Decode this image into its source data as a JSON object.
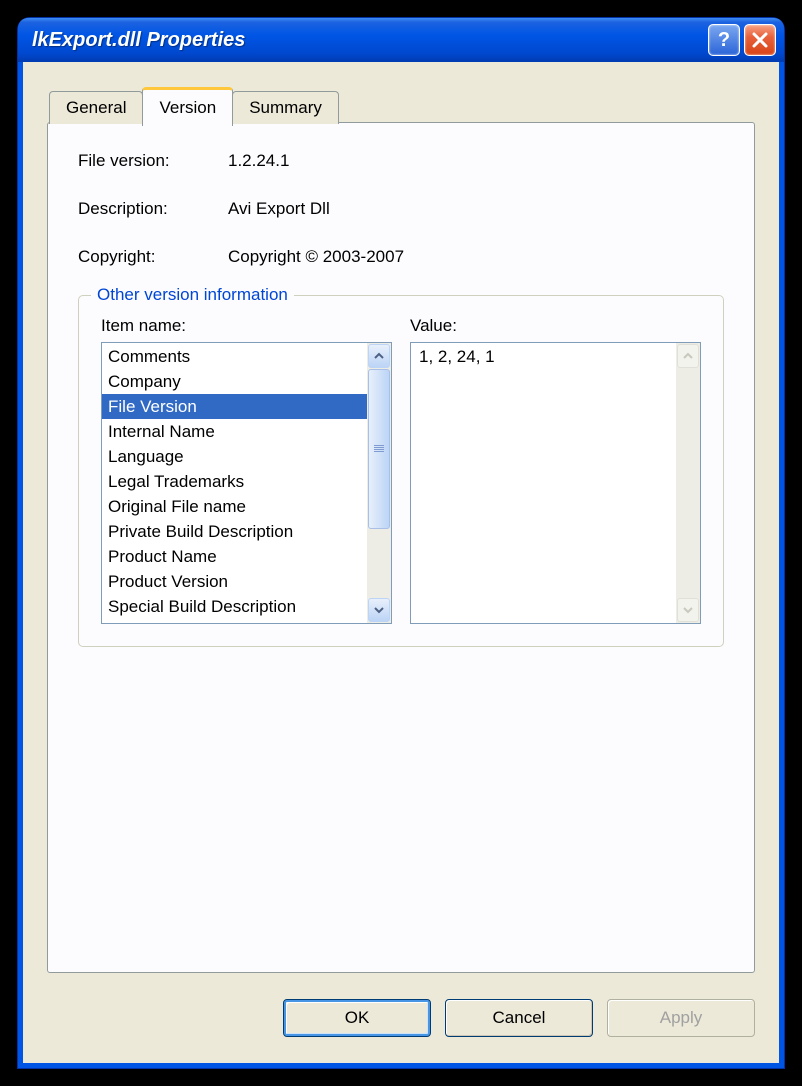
{
  "window": {
    "title": "lkExport.dll Properties"
  },
  "tabs": {
    "general": "General",
    "version": "Version",
    "summary": "Summary"
  },
  "info": {
    "file_version_label": "File version:",
    "file_version_value": "1.2.24.1",
    "description_label": "Description:",
    "description_value": "Avi Export Dll",
    "copyright_label": "Copyright:",
    "copyright_value": "Copyright © 2003-2007"
  },
  "group": {
    "legend": "Other version information",
    "item_name_label": "Item name:",
    "value_label": "Value:",
    "items": [
      "Comments",
      "Company",
      "File Version",
      "Internal Name",
      "Language",
      "Legal Trademarks",
      "Original File name",
      "Private Build Description",
      "Product Name",
      "Product Version",
      "Special Build Description"
    ],
    "selected_index": 2,
    "value_text": "1, 2, 24, 1"
  },
  "buttons": {
    "ok": "OK",
    "cancel": "Cancel",
    "apply": "Apply"
  }
}
